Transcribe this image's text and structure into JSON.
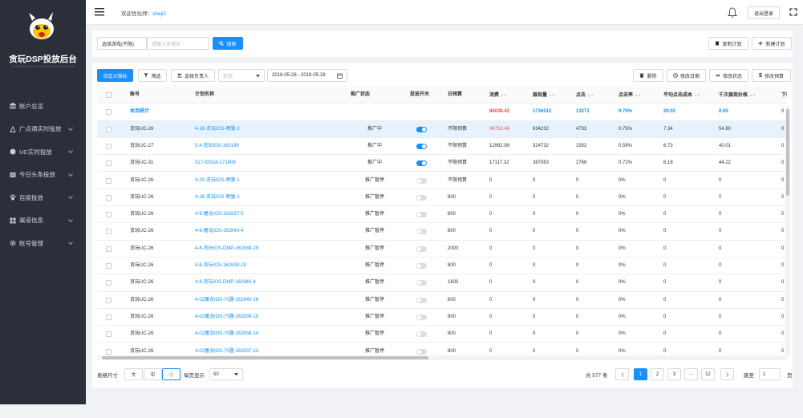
{
  "brand": {
    "title": "贪玩DSP投放后台",
    "subtitle": "TANWAN DSP LAUNCH BACKGROUND"
  },
  "sidebar": {
    "items": [
      {
        "label": "账户总览",
        "icon": "bank-icon",
        "has_arrow": false
      },
      {
        "label": "广点通实时投放",
        "icon": "tencent-icon",
        "has_arrow": true
      },
      {
        "label": "UC实时投放",
        "icon": "uc-icon",
        "has_arrow": true
      },
      {
        "label": "今日头条投放",
        "icon": "newspaper-icon",
        "has_arrow": true
      },
      {
        "label": "百度投放",
        "icon": "paw-icon",
        "has_arrow": true
      },
      {
        "label": "渠道信息",
        "icon": "grid-icon",
        "has_arrow": true
      },
      {
        "label": "账号管理",
        "icon": "gear-icon",
        "has_arrow": true
      }
    ]
  },
  "topbar": {
    "welcome": "欢迎优化师：",
    "user": "sheji2",
    "logout": "退出登录"
  },
  "search": {
    "game_select": "选择游戏(不限)",
    "keyword_placeholder": "请输入关键字",
    "search_button": "搜索",
    "copy_plan": "复制计划",
    "new_plan": "新建计划"
  },
  "toolbar": {
    "custom_metrics": "自定义指标",
    "filter": "筛选",
    "select_owner": "选择负责人",
    "status_placeholder": "状态",
    "date_range": "2018-05-28 - 2018-05-28",
    "delete": "删除",
    "edit_date": "修改日期",
    "edit_status": "修改状态",
    "edit_budget": "修改预算"
  },
  "table": {
    "columns": [
      "账号",
      "计划名称",
      "推广状态",
      "投放开关",
      "日预算",
      "消费",
      "展现量",
      "点击",
      "点击率",
      "平均点击成本",
      "千次展现价格",
      "下载"
    ],
    "total": {
      "label": "本页统计",
      "spend": "86038.42",
      "impressions": "1736512",
      "clicks": "13271",
      "ctr": "0.76%",
      "avg_cpc": "29.02",
      "cpm": "0.05",
      "downloads": "0"
    },
    "rows": [
      {
        "account": "贪玩UC-26",
        "plan": "4-18-贪玩IOS-晒量-2",
        "status": "推广中",
        "switch": true,
        "budget": "不限预算",
        "spend": "34753.46",
        "impressions": "634232",
        "clicks": "4733",
        "ctr": "0.75%",
        "avg_cpc": "7.34",
        "cpm": "54.80",
        "downloads": "0",
        "selected": true,
        "spend_red": true
      },
      {
        "account": "贪玩UC-27",
        "plan": "5.4-贪玩IOS-163199",
        "status": "推广中",
        "switch": true,
        "budget": "不限预算",
        "spend": "12992.99",
        "impressions": "324732",
        "clicks": "1932",
        "ctr": "0.59%",
        "avg_cpc": "6.73",
        "cpm": "40.01",
        "downloads": "0",
        "selected": false,
        "spend_red": false
      },
      {
        "account": "贪玩UC-31",
        "plan": "517-IOSsb-171609",
        "status": "推广中",
        "switch": true,
        "budget": "不限预算",
        "spend": "17117.32",
        "impressions": "387063",
        "clicks": "2768",
        "ctr": "0.72%",
        "avg_cpc": "6.18",
        "cpm": "44.22",
        "downloads": "0",
        "selected": false,
        "spend_red": false
      },
      {
        "account": "贪玩UC-26",
        "plan": "4-20-贪玩IOS-晒量-1",
        "status": "推广暂停",
        "switch": false,
        "budget": "不限预算",
        "spend": "0",
        "impressions": "0",
        "clicks": "0",
        "ctr": "0%",
        "avg_cpc": "0",
        "cpm": "0",
        "downloads": "0",
        "selected": false,
        "spend_red": false
      },
      {
        "account": "贪玩UC-26",
        "plan": "4-18-贪玩IOS-晒量-1",
        "status": "推广暂停",
        "switch": false,
        "budget": "800",
        "spend": "0",
        "impressions": "0",
        "clicks": "0",
        "ctr": "0%",
        "avg_cpc": "0",
        "cpm": "0",
        "downloads": "0",
        "selected": false,
        "spend_red": false
      },
      {
        "account": "贪玩UC-26",
        "plan": "4-9-屠龙IOS-162837-5",
        "status": "推广暂停",
        "switch": false,
        "budget": "800",
        "spend": "0",
        "impressions": "0",
        "clicks": "0",
        "ctr": "0%",
        "avg_cpc": "0",
        "cpm": "0",
        "downloads": "0",
        "selected": false,
        "spend_red": false
      },
      {
        "account": "贪玩UC-26",
        "plan": "4-9-屠龙IOS-162840-4",
        "status": "推广暂停",
        "switch": false,
        "budget": "800",
        "spend": "0",
        "impressions": "0",
        "clicks": "0",
        "ctr": "0%",
        "avg_cpc": "0",
        "cpm": "0",
        "downloads": "0",
        "selected": false,
        "spend_red": false
      },
      {
        "account": "贪玩UC-26",
        "plan": "4-8-贪玩IOS-DMP-162838-19",
        "status": "推广暂停",
        "switch": false,
        "budget": "2000",
        "spend": "0",
        "impressions": "0",
        "clicks": "0",
        "ctr": "0%",
        "avg_cpc": "0",
        "cpm": "0",
        "downloads": "0",
        "selected": false,
        "spend_red": false
      },
      {
        "account": "贪玩UC-26",
        "plan": "4-8-贪玩IOS-162838-18",
        "status": "推广暂停",
        "switch": false,
        "budget": "800",
        "spend": "0",
        "impressions": "0",
        "clicks": "0",
        "ctr": "0%",
        "avg_cpc": "0",
        "cpm": "0",
        "downloads": "0",
        "selected": false,
        "spend_red": false
      },
      {
        "account": "贪玩UC-26",
        "plan": "4-8-贪玩IOS-DMP-162840-4",
        "status": "推广暂停",
        "switch": false,
        "budget": "1600",
        "spend": "0",
        "impressions": "0",
        "clicks": "0",
        "ctr": "0%",
        "avg_cpc": "0",
        "cpm": "0",
        "downloads": "0",
        "selected": false,
        "spend_red": false
      },
      {
        "account": "贪玩UC-26",
        "plan": "4-02屠龙IOS-兴趣-162840-16",
        "status": "推广暂停",
        "switch": false,
        "budget": "800",
        "spend": "0",
        "impressions": "0",
        "clicks": "0",
        "ctr": "0%",
        "avg_cpc": "0",
        "cpm": "0",
        "downloads": "0",
        "selected": false,
        "spend_red": false
      },
      {
        "account": "贪玩UC-26",
        "plan": "4-02屠龙IOS-兴趣-162839-15",
        "status": "推广暂停",
        "switch": false,
        "budget": "800",
        "spend": "0",
        "impressions": "0",
        "clicks": "0",
        "ctr": "0%",
        "avg_cpc": "0",
        "cpm": "0",
        "downloads": "0",
        "selected": false,
        "spend_red": false
      },
      {
        "account": "贪玩UC-26",
        "plan": "4-02屠龙IOS-兴趣-162838-14",
        "status": "推广暂停",
        "switch": false,
        "budget": "800",
        "spend": "0",
        "impressions": "0",
        "clicks": "0",
        "ctr": "0%",
        "avg_cpc": "0",
        "cpm": "0",
        "downloads": "0",
        "selected": false,
        "spend_red": false
      },
      {
        "account": "贪玩UC-26",
        "plan": "4-02屠龙IOS-兴趣-162837-13",
        "status": "推广暂停",
        "switch": false,
        "budget": "800",
        "spend": "0",
        "impressions": "0",
        "clicks": "0",
        "ctr": "0%",
        "avg_cpc": "0",
        "cpm": "0",
        "downloads": "0",
        "selected": false,
        "spend_red": false
      }
    ]
  },
  "footer": {
    "table_size_label": "表格尺寸",
    "sizes": [
      "大",
      "中",
      "小"
    ],
    "active_size": "小",
    "per_page_label": "每页显示",
    "per_page": "50",
    "total": "共 577 条",
    "pages": [
      "1",
      "2",
      "3",
      "···",
      "12"
    ],
    "current_page": "1",
    "jump_label": "跳至",
    "jump_value": "1",
    "page_unit": "页"
  },
  "colors": {
    "primary": "#1890ff",
    "sidebar": "#2b2f3a",
    "spend_red": "#e84c3d"
  }
}
